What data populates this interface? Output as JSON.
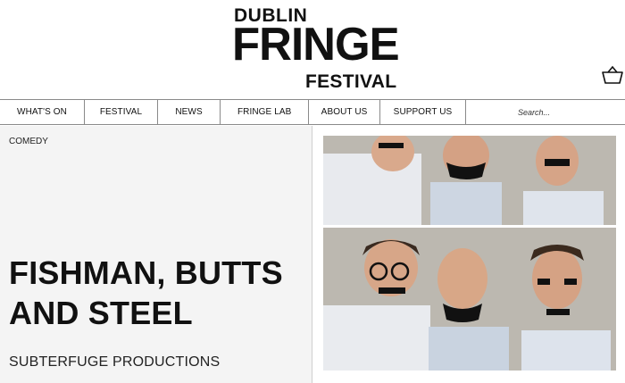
{
  "logo": {
    "line1": "DUBLIN",
    "line2": "FRINGE",
    "line3": "FESTIVAL"
  },
  "header": {
    "basket_icon": "basket-icon"
  },
  "nav": {
    "items": [
      {
        "label": "WHAT'S ON"
      },
      {
        "label": "FESTIVAL"
      },
      {
        "label": "NEWS"
      },
      {
        "label": "FRINGE LAB"
      },
      {
        "label": "ABOUT US"
      },
      {
        "label": "SUPPORT US"
      }
    ],
    "search_placeholder": "Search..."
  },
  "show": {
    "category": "COMEDY",
    "title_line1": "FISHMAN, BUTTS",
    "title_line2": "AND STEEL",
    "producer": "SUBTERFUGE PRODUCTIONS"
  },
  "colors": {
    "text": "#111111",
    "panel_bg": "#f4f4f4",
    "divider": "#8a8a8a",
    "photo_backdrop": "#b9b5ae"
  }
}
